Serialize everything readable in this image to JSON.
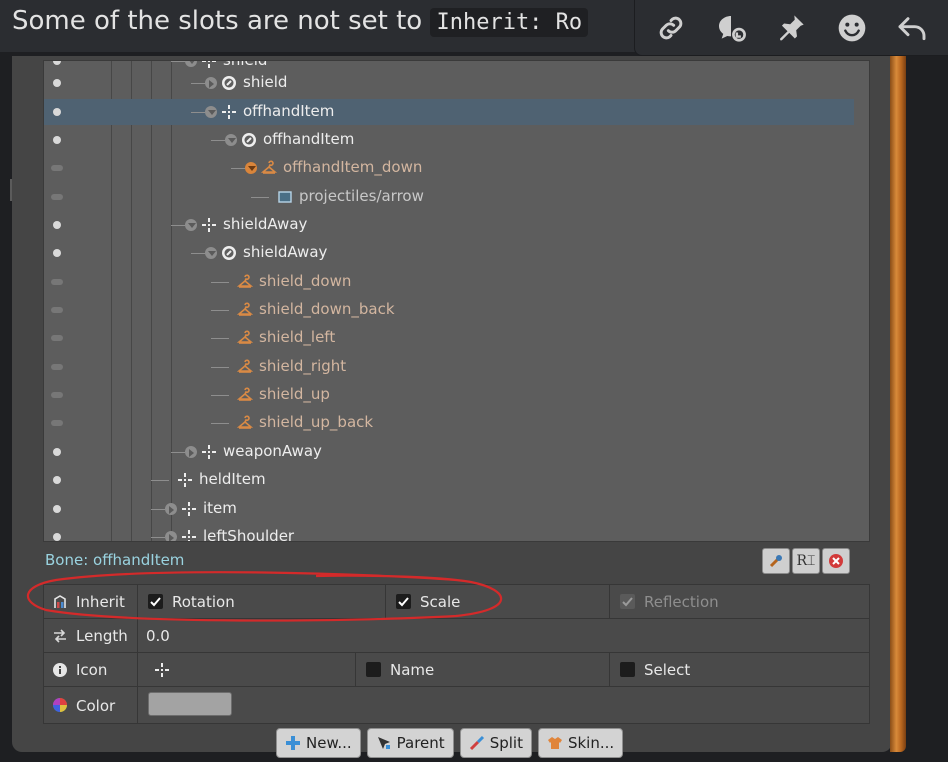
{
  "message": {
    "prefix": "Some of the slots are not set to ",
    "code": "Inherit: Ro"
  },
  "toolbar": {
    "icons": [
      "link-icon",
      "thread-icon",
      "pin-icon",
      "emoji-icon",
      "reply-icon"
    ]
  },
  "tree": {
    "rows": [
      {
        "label": "shield",
        "kind": "bone"
      },
      {
        "label": "shield",
        "kind": "slot"
      },
      {
        "label": "offhandItem",
        "kind": "bone"
      },
      {
        "label": "offhandItem",
        "kind": "slot"
      },
      {
        "label": "offhandItem_down",
        "kind": "skin-placeholder"
      },
      {
        "label": "projectiles/arrow",
        "kind": "attachment"
      },
      {
        "label": "shieldAway",
        "kind": "bone"
      },
      {
        "label": "shieldAway",
        "kind": "slot"
      },
      {
        "label": "shield_down",
        "kind": "skin-placeholder"
      },
      {
        "label": "shield_down_back",
        "kind": "skin-placeholder"
      },
      {
        "label": "shield_left",
        "kind": "skin-placeholder"
      },
      {
        "label": "shield_right",
        "kind": "skin-placeholder"
      },
      {
        "label": "shield_up",
        "kind": "skin-placeholder"
      },
      {
        "label": "shield_up_back",
        "kind": "skin-placeholder"
      },
      {
        "label": "weaponAway",
        "kind": "bone"
      },
      {
        "label": "heldItem",
        "kind": "bone"
      },
      {
        "label": "item",
        "kind": "bone"
      },
      {
        "label": "leftShoulder",
        "kind": "bone"
      }
    ],
    "selected_row": "offhandItem"
  },
  "bone_panel": {
    "title": "Bone: offhandItem",
    "inherit_label": "Inherit",
    "rotation_label": "Rotation",
    "rotation_checked": true,
    "scale_label": "Scale",
    "scale_checked": true,
    "reflection_label": "Reflection",
    "reflection_checked": true,
    "length_label": "Length",
    "length_value": "0.0",
    "icon_label": "Icon",
    "name_label": "Name",
    "name_checked": false,
    "select_label": "Select",
    "select_checked": false,
    "color_label": "Color",
    "color_value": "#a3a3a3"
  },
  "actions": {
    "new": "New...",
    "parent": "Parent",
    "split": "Split",
    "skin": "Skin..."
  },
  "colors": {
    "selection": "#4f6272",
    "bone_label_color": "#9ad3e0",
    "annotation": "#d42a2a"
  }
}
